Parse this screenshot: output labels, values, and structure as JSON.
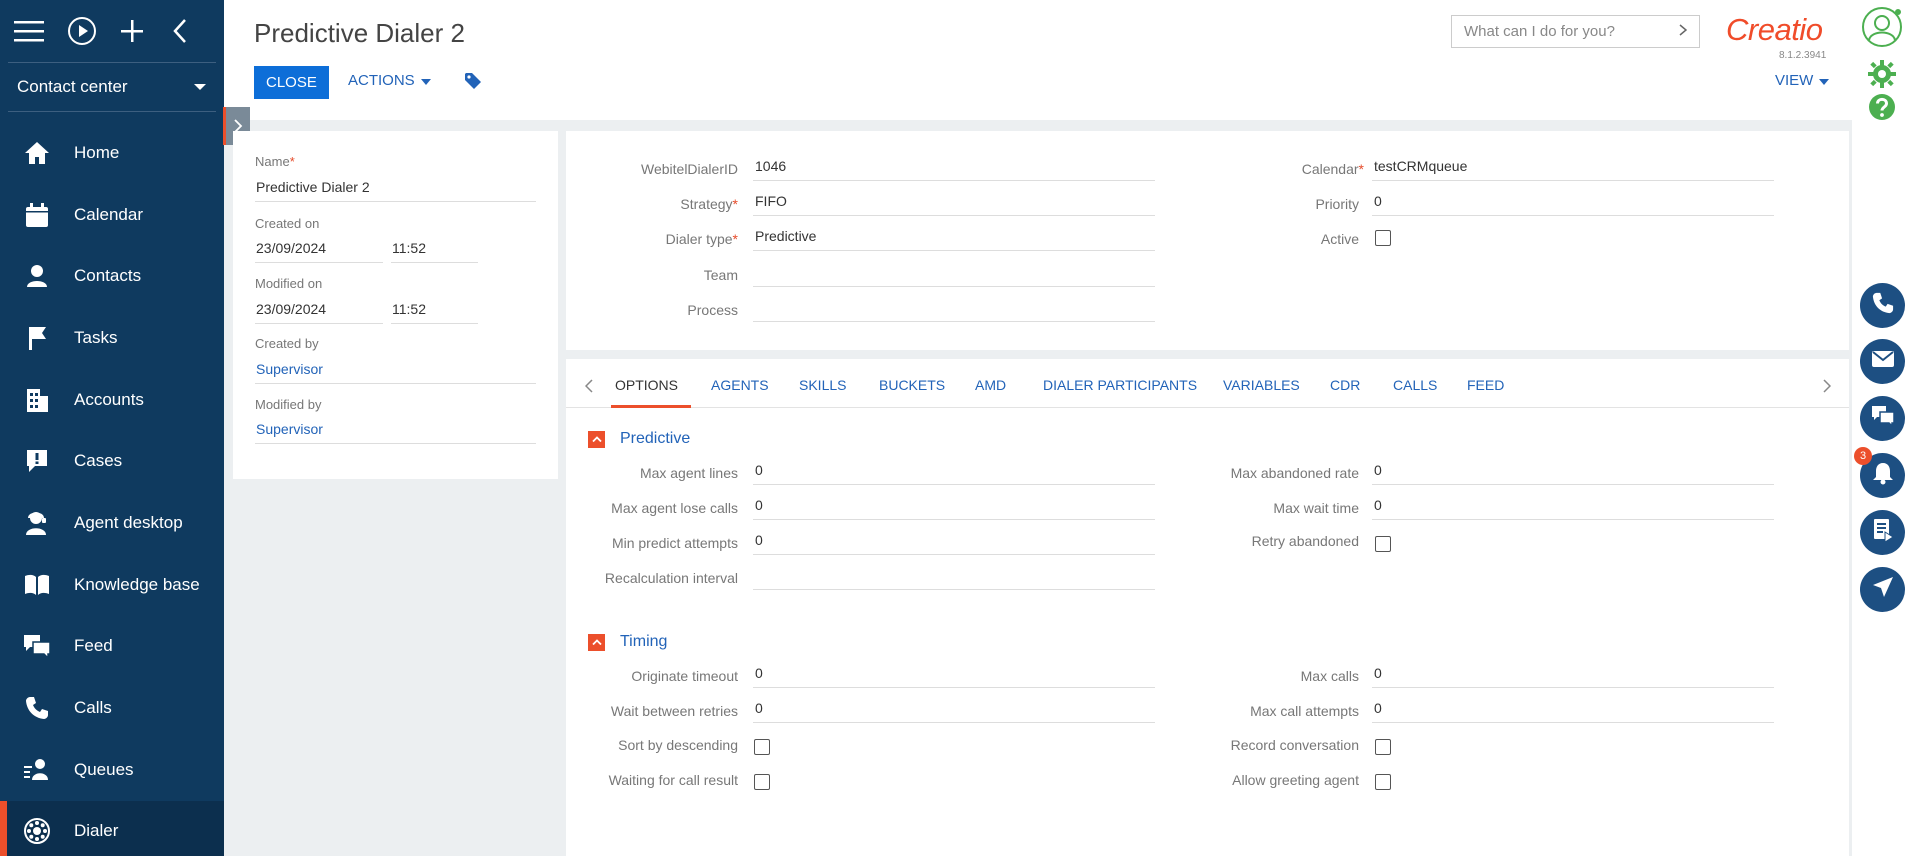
{
  "sidebar": {
    "workspace": "Contact center",
    "items": [
      {
        "label": "Home"
      },
      {
        "label": "Calendar"
      },
      {
        "label": "Contacts"
      },
      {
        "label": "Tasks"
      },
      {
        "label": "Accounts"
      },
      {
        "label": "Cases"
      },
      {
        "label": "Agent desktop"
      },
      {
        "label": "Knowledge base"
      },
      {
        "label": "Feed"
      },
      {
        "label": "Calls"
      },
      {
        "label": "Queues"
      },
      {
        "label": "Dialer"
      }
    ],
    "active_item": "Dialer"
  },
  "header": {
    "title": "Predictive Dialer 2",
    "close_label": "CLOSE",
    "actions_label": "ACTIONS",
    "search_placeholder": "What can I do for you?",
    "logo": "Creatio",
    "version": "8.1.2.3941",
    "view_label": "VIEW"
  },
  "left_panel": {
    "name_label": "Name",
    "name_value": "Predictive Dialer 2",
    "created_on_label": "Created on",
    "created_on_date": "23/09/2024",
    "created_on_time": "11:52",
    "modified_on_label": "Modified on",
    "modified_on_date": "23/09/2024",
    "modified_on_time": "11:52",
    "created_by_label": "Created by",
    "created_by_value": "Supervisor",
    "modified_by_label": "Modified by",
    "modified_by_value": "Supervisor"
  },
  "main_fields": {
    "webitel_dialer_id_label": "WebitelDialerID",
    "webitel_dialer_id_value": "1046",
    "strategy_label": "Strategy",
    "strategy_value": "FIFO",
    "dialer_type_label": "Dialer type",
    "dialer_type_value": "Predictive",
    "team_label": "Team",
    "team_value": "",
    "process_label": "Process",
    "process_value": "",
    "calendar_label": "Calendar",
    "calendar_value": "testCRMqueue",
    "priority_label": "Priority",
    "priority_value": "0",
    "active_label": "Active",
    "active_checked": false
  },
  "tabs": [
    {
      "label": "OPTIONS"
    },
    {
      "label": "AGENTS"
    },
    {
      "label": "SKILLS"
    },
    {
      "label": "BUCKETS"
    },
    {
      "label": "AMD"
    },
    {
      "label": "DIALER PARTICIPANTS"
    },
    {
      "label": "VARIABLES"
    },
    {
      "label": "CDR"
    },
    {
      "label": "CALLS"
    },
    {
      "label": "FEED"
    }
  ],
  "active_tab": "OPTIONS",
  "predictive": {
    "title": "Predictive",
    "max_agent_lines_label": "Max agent lines",
    "max_agent_lines_value": "0",
    "max_agent_lose_calls_label": "Max agent lose calls",
    "max_agent_lose_calls_value": "0",
    "min_predict_attempts_label": "Min predict attempts",
    "min_predict_attempts_value": "0",
    "recalculation_interval_label": "Recalculation interval",
    "recalculation_interval_value": "",
    "max_abandoned_rate_label": "Max abandoned rate",
    "max_abandoned_rate_value": "0",
    "max_wait_time_label": "Max wait time",
    "max_wait_time_value": "0",
    "retry_abandoned_label": "Retry abandoned"
  },
  "timing": {
    "title": "Timing",
    "originate_timeout_label": "Originate timeout",
    "originate_timeout_value": "0",
    "wait_between_retries_label": "Wait between retries",
    "wait_between_retries_value": "0",
    "sort_by_descending_label": "Sort by descending",
    "waiting_for_call_result_label": "Waiting for call result",
    "max_calls_label": "Max calls",
    "max_calls_value": "0",
    "max_call_attempts_label": "Max call attempts",
    "max_call_attempts_value": "0",
    "record_conversation_label": "Record conversation",
    "allow_greeting_agent_label": "Allow greeting agent"
  },
  "rail": {
    "notifications_count": "3"
  },
  "colors": {
    "sidebar_bg": "#0f3a5f",
    "accent": "#ec4f2b",
    "primary_button": "#0d6ed8",
    "link": "#2263b8",
    "brand_green": "#4caf50"
  }
}
